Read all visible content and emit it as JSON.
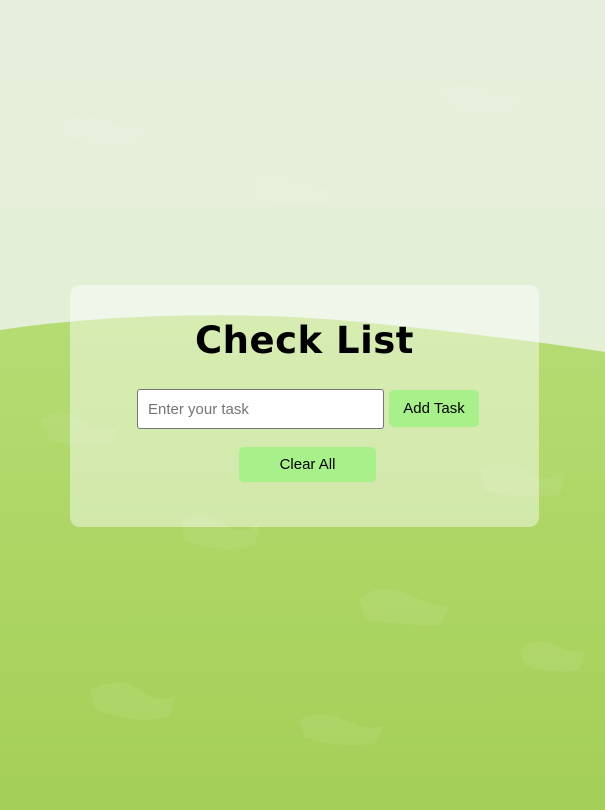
{
  "page": {
    "title": "Check List"
  },
  "task_form": {
    "input_placeholder": "Enter your task",
    "input_value": "",
    "add_button_label": "Add Task",
    "clear_button_label": "Clear All"
  },
  "colors": {
    "button_green": "#a8f08a",
    "background_top": "#e3efd2",
    "background_bottom": "#a4cf56"
  }
}
